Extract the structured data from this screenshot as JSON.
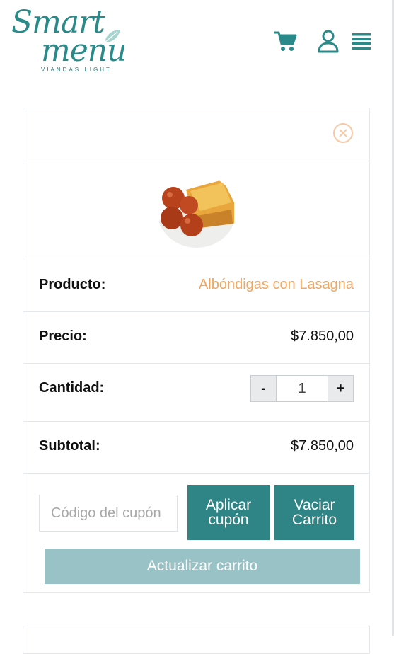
{
  "brand": {
    "line1": "Smart",
    "line2": "menu",
    "tagline": "VIANDAS LIGHT",
    "color": "#2a8a8a"
  },
  "header": {
    "icons": [
      "cart-icon",
      "user-icon",
      "menu-icon"
    ],
    "icon_color": "#2a8a8a"
  },
  "cart": {
    "remove_icon": "close-circle-icon",
    "product_label": "Producto:",
    "product_name": "Albóndigas con Lasagna",
    "price_label": "Precio:",
    "price_value": "$7.850,00",
    "qty_label": "Cantidad:",
    "qty_minus": "-",
    "qty_value": "1",
    "qty_plus": "+",
    "subtotal_label": "Subtotal:",
    "subtotal_value": "$7.850,00"
  },
  "actions": {
    "coupon_placeholder": "Código del cupón",
    "apply_line1": "Aplicar",
    "apply_line2": "cupón",
    "empty_line1": "Vaciar",
    "empty_line2": "Carrito",
    "update_label": "Actualizar carrito"
  },
  "colors": {
    "teal": "#2f8585",
    "teal_light": "#99c2c6",
    "accent_orange": "#f2a55e"
  }
}
